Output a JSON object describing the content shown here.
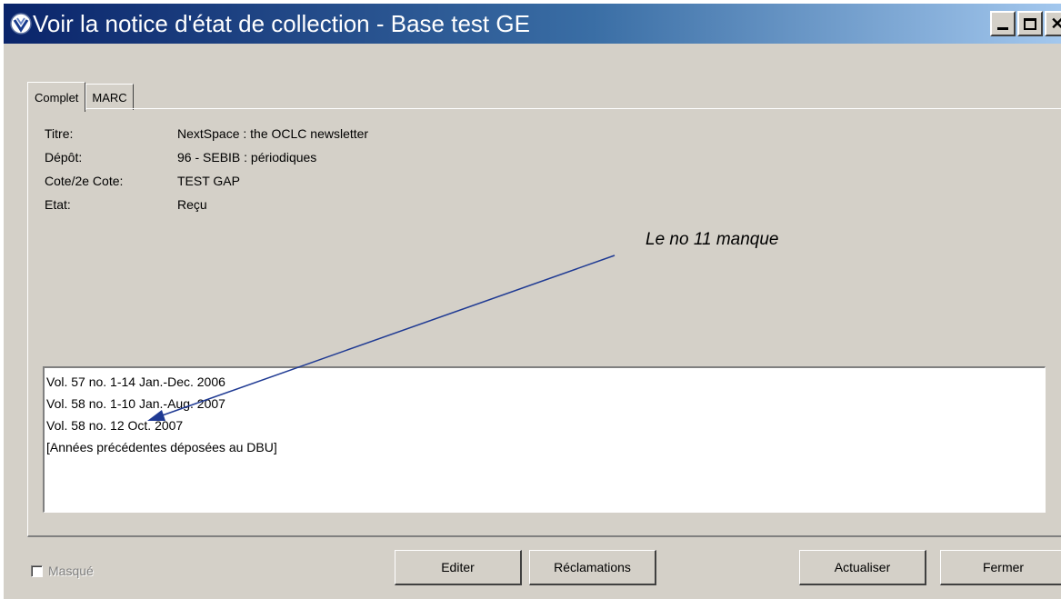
{
  "window": {
    "title": "Voir la notice d'état de collection - Base test GE",
    "icon": "app-logo-icon",
    "controls": [
      "minimize-icon",
      "maximize-icon",
      "close-icon"
    ]
  },
  "tabs": [
    {
      "label": "Complet",
      "active": true
    },
    {
      "label": "MARC",
      "active": false
    }
  ],
  "record": {
    "fields": [
      {
        "label": "Titre:",
        "value": "NextSpace : the OCLC newsletter"
      },
      {
        "label": "Dépôt:",
        "value": "96 - SEBIB : périodiques"
      },
      {
        "label": "Cote/2e Cote:",
        "value": "TEST GAP"
      },
      {
        "label": "Etat:",
        "value": "Reçu"
      }
    ]
  },
  "holdings": [
    "Vol. 57 no. 1-14   Jan.-Dec. 2006",
    "Vol. 58 no. 1-10   Jan.-Aug. 2007",
    "Vol. 58 no. 12   Oct. 2007",
    "[Années précédentes déposées au DBU]"
  ],
  "annotation": {
    "text": "Le no 11 manque",
    "arrow_color": "#1f3a93"
  },
  "footer": {
    "hidden_checkbox_label": "Masqué",
    "hidden_checkbox_checked": false,
    "buttons": {
      "edit": "Editer",
      "claims": "Réclamations",
      "refresh": "Actualiser",
      "close": "Fermer"
    }
  },
  "colors": {
    "window_bg": "#d4d0c8",
    "title_gradient_start": "#0a246a",
    "title_gradient_end": "#a6caf0"
  }
}
